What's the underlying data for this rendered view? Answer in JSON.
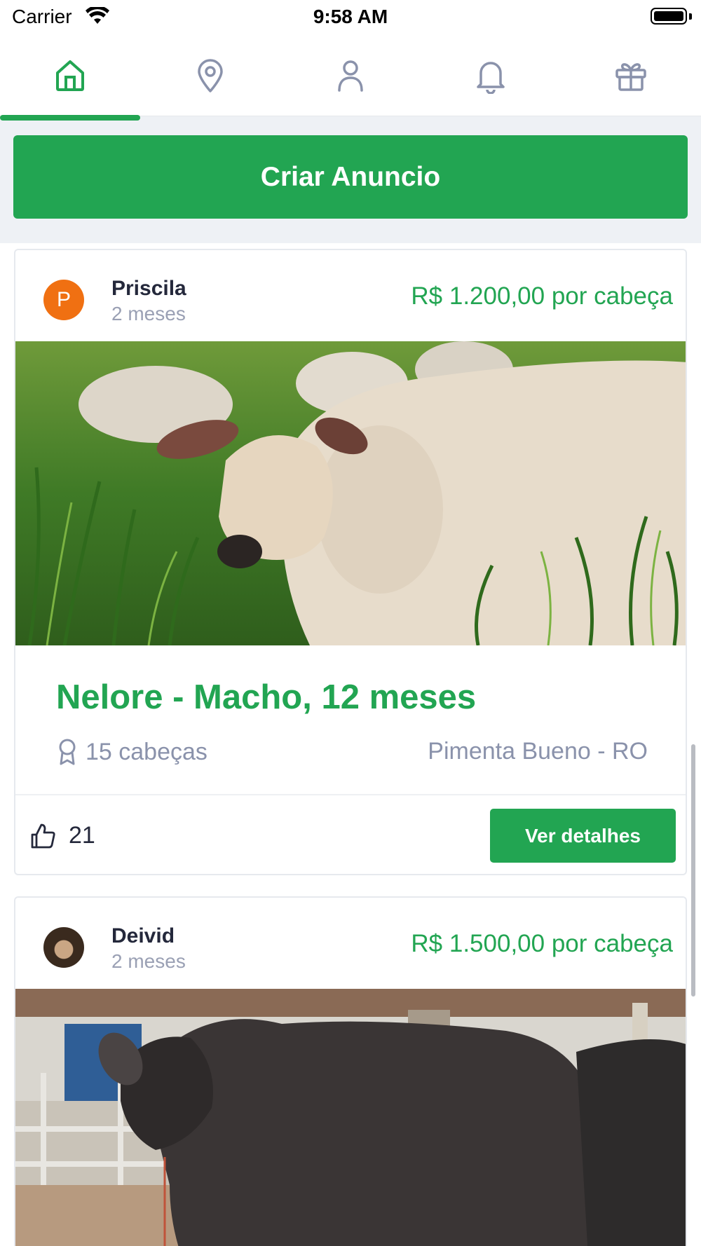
{
  "status_bar": {
    "carrier": "Carrier",
    "time": "9:58 AM"
  },
  "tabs": [
    {
      "id": "home",
      "icon": "home-icon",
      "active": true
    },
    {
      "id": "location",
      "icon": "map-pin-icon",
      "active": false
    },
    {
      "id": "profile",
      "icon": "user-icon",
      "active": false
    },
    {
      "id": "notifications",
      "icon": "bell-icon",
      "active": false
    },
    {
      "id": "gifts",
      "icon": "gift-icon",
      "active": false
    }
  ],
  "create_button": {
    "label": "Criar Anuncio"
  },
  "posts": [
    {
      "author": "Priscila",
      "avatar_initial": "P",
      "avatar_color": "#f07012",
      "time": "2 meses",
      "price": "R$ 1.200,00 por cabeça",
      "title": "Nelore - Macho, 12 meses",
      "heads": "15 cabeças",
      "location": "Pimenta Bueno - RO",
      "likes": "21",
      "details_label": "Ver detalhes"
    },
    {
      "author": "Deivid",
      "time": "2 meses",
      "price": "R$ 1.500,00 por cabeça"
    }
  ],
  "colors": {
    "accent": "#22a552",
    "muted": "#9aa0b4",
    "background": "#eef1f5"
  }
}
